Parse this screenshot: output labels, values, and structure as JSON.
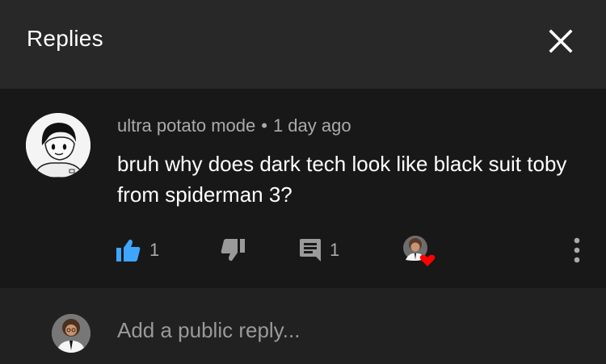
{
  "header": {
    "title": "Replies",
    "close_icon": "close-icon"
  },
  "comment": {
    "author": "ultra potato mode",
    "separator": "•",
    "time": "1 day ago",
    "text": "bruh why does dark tech look like black suit toby from spiderman 3?",
    "likes": "1",
    "replies": "1",
    "accent": "#3ea6ff",
    "heart_color": "#ff0000",
    "icons": [
      "thumbs-up-icon",
      "thumbs-down-icon",
      "reply-icon",
      "creator-heart-icon",
      "more-vert-icon"
    ]
  },
  "reply_box": {
    "placeholder": "Add a public reply..."
  }
}
